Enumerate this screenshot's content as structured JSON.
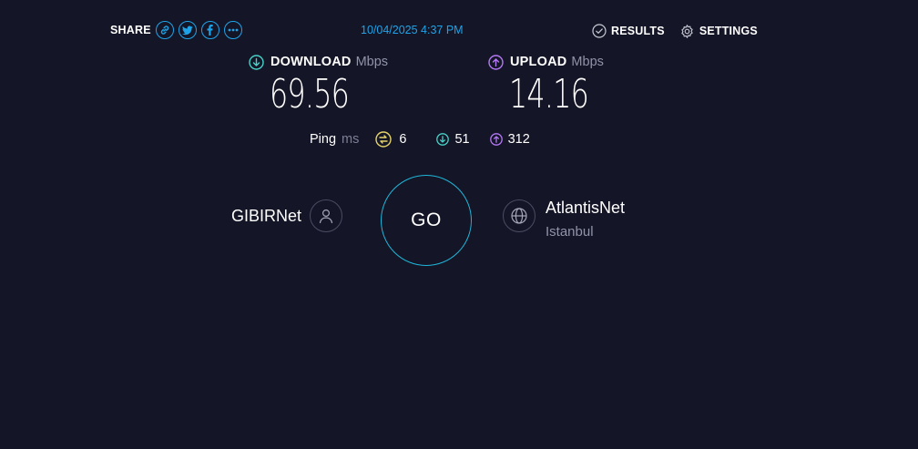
{
  "share": {
    "label": "SHARE",
    "buttons": [
      "link-icon",
      "twitter-icon",
      "facebook-icon",
      "more-icon"
    ]
  },
  "timestamp": "10/04/2025 4:37 PM",
  "nav": {
    "results_label": "RESULTS",
    "settings_label": "SETTINGS"
  },
  "download": {
    "title": "DOWNLOAD",
    "unit": "Mbps",
    "value": "69.56",
    "accent": "#47d1c8"
  },
  "upload": {
    "title": "UPLOAD",
    "unit": "Mbps",
    "value": "14.16",
    "accent": "#b479f5"
  },
  "ping": {
    "label": "Ping",
    "unit": "ms",
    "idle": "6",
    "download": "51",
    "upload": "312",
    "idle_color": "#e5d46a"
  },
  "isp": {
    "name": "GIBIRNet"
  },
  "go": {
    "label": "GO",
    "ring_color": "#1fb6d9"
  },
  "server": {
    "name": "AtlantisNet",
    "location": "Istanbul"
  },
  "colors": {
    "background": "#141526",
    "accent_blue": "#1fa3e8",
    "muted_text": "#9193a8"
  }
}
